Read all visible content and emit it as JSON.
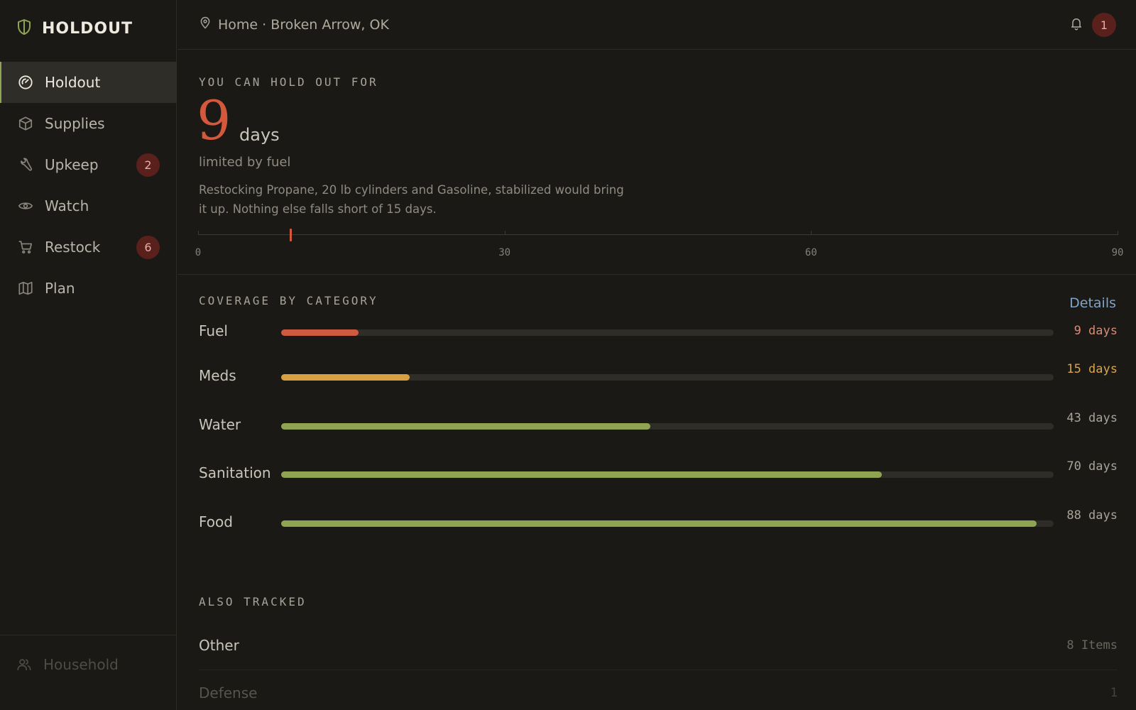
{
  "app": {
    "name": "HOLDOUT",
    "accent": "#8fa451"
  },
  "sidebar": {
    "items": [
      {
        "label": "Holdout",
        "icon": "gauge-icon",
        "active": true,
        "badge": ""
      },
      {
        "label": "Supplies",
        "icon": "box-icon",
        "active": false,
        "badge": ""
      },
      {
        "label": "Upkeep",
        "icon": "wrench-icon",
        "active": false,
        "badge": "2"
      },
      {
        "label": "Watch",
        "icon": "eye-icon",
        "active": false,
        "badge": ""
      },
      {
        "label": "Restock",
        "icon": "cart-icon",
        "active": false,
        "badge": "6"
      },
      {
        "label": "Plan",
        "icon": "map-icon",
        "active": false,
        "badge": ""
      }
    ],
    "footer": {
      "label": "Household",
      "icon": "users-icon"
    }
  },
  "topbar": {
    "location": "Home · Broken Arrow, OK",
    "notifications": "1"
  },
  "holdout": {
    "eyebrow": "YOU CAN HOLD OUT FOR",
    "days": "9",
    "unit": "days",
    "limited_by": "limited by fuel",
    "hint": "Restocking Propane, 20 lb cylinders and Gasoline, stabilized would bring it up. Nothing else falls short of 15 days.",
    "scale": {
      "min": 0,
      "max": 90,
      "ticks": [
        "0",
        "30",
        "60",
        "90"
      ],
      "marker_value": 9,
      "marker_color": "#d4583c"
    }
  },
  "coverage": {
    "eyebrow": "COVERAGE BY CATEGORY",
    "details_label": "Details",
    "max_days": 90,
    "rows": [
      {
        "label": "Fuel",
        "days": 9,
        "value_text": "9 days",
        "color": "#cf5a42",
        "value_color": "#d98a78"
      },
      {
        "label": "Meds",
        "days": 15,
        "value_text": "15 days",
        "color": "#d9a040",
        "value_color": "#d9a548"
      },
      {
        "label": "Water",
        "days": 43,
        "value_text": "43 days",
        "color": "#8fa451",
        "value_color": "#a8a398"
      },
      {
        "label": "Sanitation",
        "days": 70,
        "value_text": "70 days",
        "color": "#8fa451",
        "value_color": "#a8a398"
      },
      {
        "label": "Food",
        "days": 88,
        "value_text": "88 days",
        "color": "#8fa451",
        "value_color": "#a8a398"
      }
    ]
  },
  "also_tracked": {
    "eyebrow": "ALSO TRACKED",
    "rows": [
      {
        "name": "Other",
        "count": "8 Items"
      },
      {
        "name": "Defense",
        "count": "1"
      }
    ]
  }
}
